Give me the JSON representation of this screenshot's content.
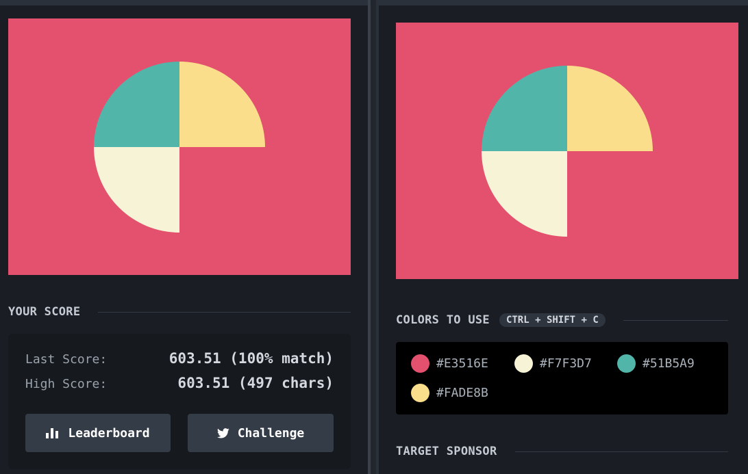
{
  "canvas": {
    "background": "#E3516E",
    "quadrant_colors": {
      "top_left": "#51B5A9",
      "top_right": "#FADE8B",
      "bottom_left": "#F7F3D7"
    }
  },
  "score": {
    "title": "YOUR SCORE",
    "last_label": "Last Score:",
    "last_value": "603.51 (100% match)",
    "high_label": "High Score:",
    "high_value": "603.51 (497 chars)",
    "leaderboard_label": "Leaderboard",
    "challenge_label": "Challenge",
    "leaderboard_icon": "bar-chart-icon",
    "challenge_icon": "twitter-icon"
  },
  "colors": {
    "title": "COLORS TO USE",
    "shortcut": "CTRL + SHIFT + C",
    "items": [
      {
        "hex": "#E3516E",
        "label": "#E3516E"
      },
      {
        "hex": "#F7F3D7",
        "label": "#F7F3D7"
      },
      {
        "hex": "#51B5A9",
        "label": "#51B5A9"
      },
      {
        "hex": "#FADE8B",
        "label": "#FADE8B"
      }
    ]
  },
  "sponsor": {
    "title": "TARGET SPONSOR"
  }
}
